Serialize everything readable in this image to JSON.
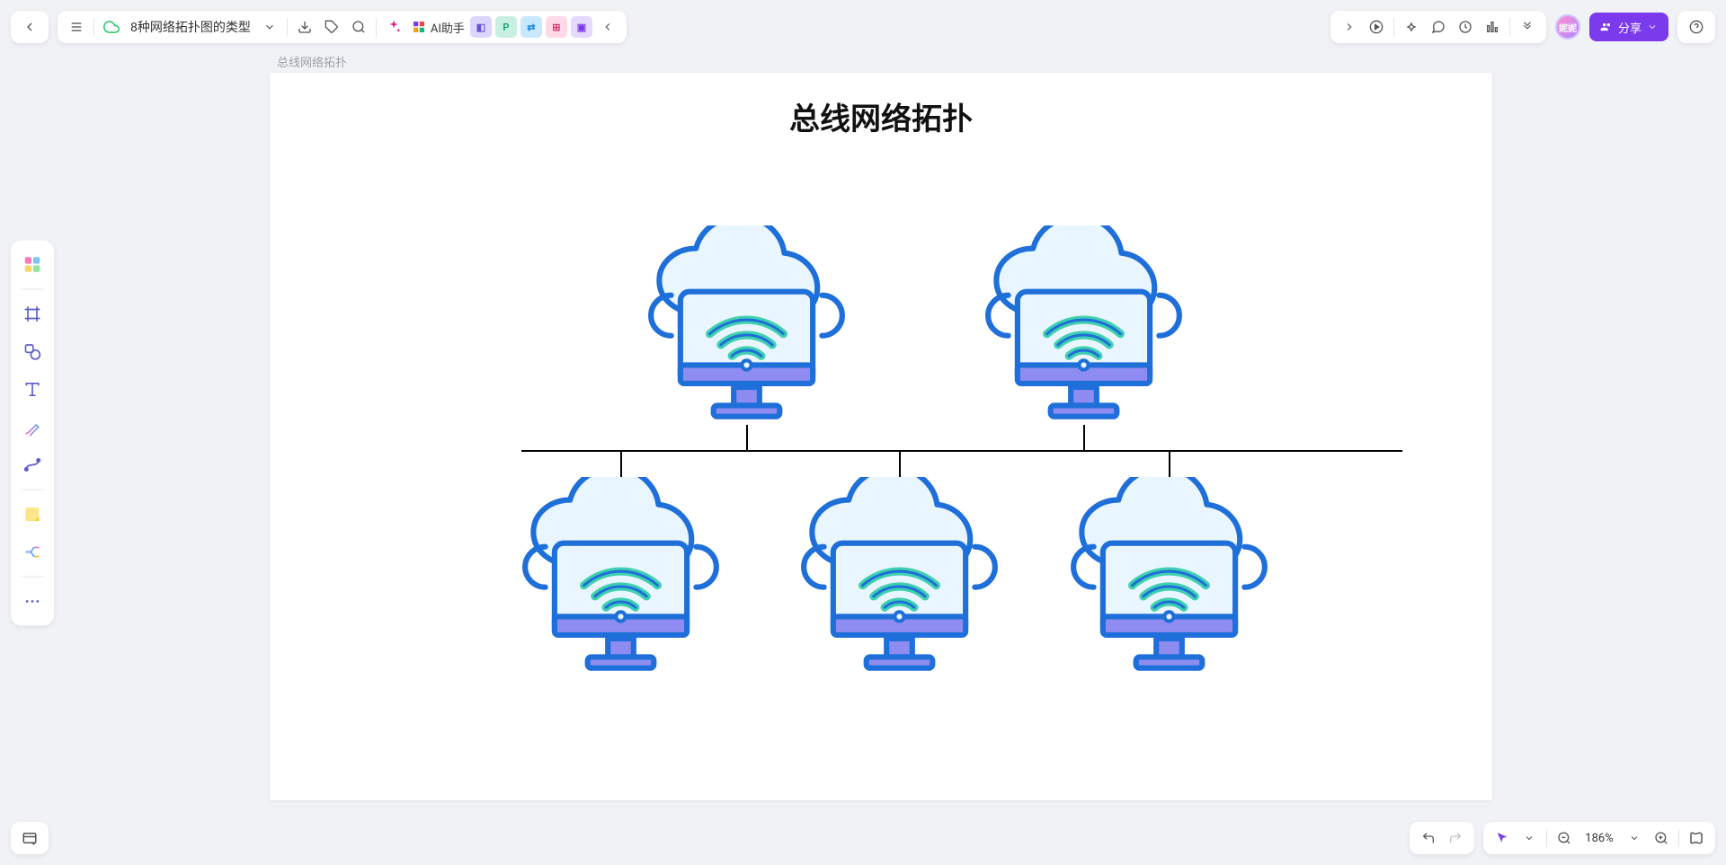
{
  "header": {
    "doc_title": "8种网络拓扑图的类型",
    "ai_label": "AI助手"
  },
  "share": {
    "label": "分享"
  },
  "page": {
    "label": "总线网络拓扑",
    "title": "总线网络拓扑"
  },
  "zoom": {
    "value": "186%"
  },
  "avatar": {
    "initials": "妮妮"
  },
  "topology": {
    "type": "bus",
    "node_count": 5,
    "rows": [
      {
        "position": "top",
        "nodes": 2
      },
      {
        "position": "bottom",
        "nodes": 3
      }
    ],
    "node_label": "cloud-wifi-computer"
  }
}
